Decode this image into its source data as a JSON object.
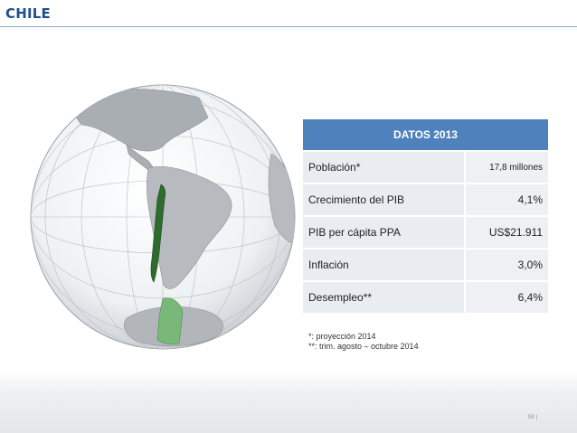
{
  "slide": {
    "title": "CHILE"
  },
  "table": {
    "header": "DATOS 2013",
    "rows": [
      {
        "label": "Población*",
        "value": "17,8 millones"
      },
      {
        "label": "Crecimiento del PIB",
        "value": "4,1%"
      },
      {
        "label": "PIB per cápita PPA",
        "value": "US$21.911"
      },
      {
        "label": "Inflación",
        "value": "3,0%"
      },
      {
        "label": "Desempleo**",
        "value": "6,4%"
      }
    ]
  },
  "notes": [
    "*: proyección 2014",
    "**: trim. agosto – octubre 2014"
  ],
  "footer": {
    "tag": "SII  |"
  },
  "colors": {
    "title": "#1f4e8c",
    "table_header": "#4f81bd",
    "chile_green": "#2e6b2e",
    "antarctic_green": "#79b879"
  }
}
